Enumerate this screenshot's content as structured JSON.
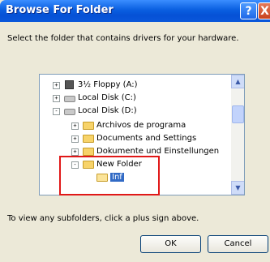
{
  "window": {
    "title": "Browse For Folder",
    "help_glyph": "?",
    "close_glyph": "X"
  },
  "instruction": "Select the folder that contains drivers for your hardware.",
  "tree": {
    "items": [
      {
        "label": "3½ Floppy (A:)",
        "expander": "+",
        "icon": "floppy-icon"
      },
      {
        "label": "Local Disk (C:)",
        "expander": "+",
        "icon": "drive-icon"
      },
      {
        "label": "Local Disk (D:)",
        "expander": "-",
        "icon": "drive-icon"
      },
      {
        "label": "Archivos de programa",
        "expander": "+",
        "icon": "folder-icon"
      },
      {
        "label": "Documents and Settings",
        "expander": "+",
        "icon": "folder-icon"
      },
      {
        "label": "Dokumente und Einstellungen",
        "expander": "+",
        "icon": "folder-icon"
      },
      {
        "label": "New Folder",
        "expander": "-",
        "icon": "folder-icon"
      },
      {
        "label": "Inf",
        "expander": "",
        "icon": "folder-open-icon",
        "selected": true
      }
    ]
  },
  "hint": "To view any subfolders, click a plus sign above.",
  "buttons": {
    "ok": "OK",
    "cancel": "Cancel"
  }
}
